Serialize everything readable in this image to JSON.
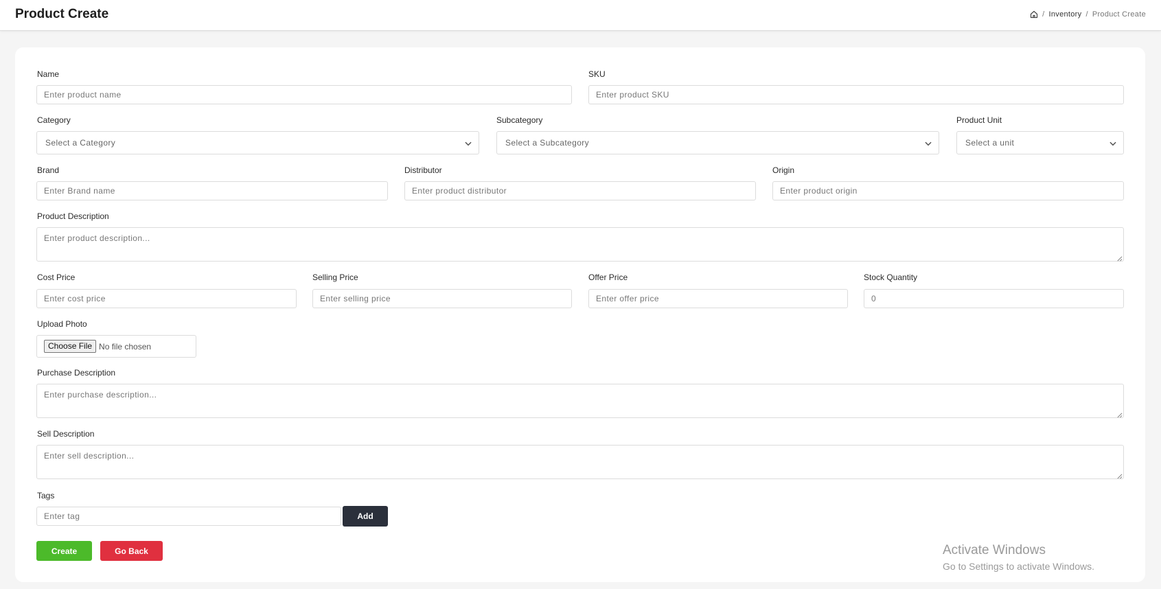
{
  "header": {
    "title": "Product Create",
    "breadcrumb": {
      "home_icon": "home-icon",
      "separator": "/",
      "items": [
        "Inventory",
        "Product Create"
      ]
    }
  },
  "form": {
    "name": {
      "label": "Name",
      "placeholder": "Enter product name"
    },
    "sku": {
      "label": "SKU",
      "placeholder": "Enter product SKU"
    },
    "category": {
      "label": "Category",
      "selected": "Select a Category"
    },
    "subcategory": {
      "label": "Subcategory",
      "selected": "Select a Subcategory"
    },
    "product_unit": {
      "label": "Product Unit",
      "selected": "Select a unit"
    },
    "brand": {
      "label": "Brand",
      "placeholder": "Enter Brand name"
    },
    "distributor": {
      "label": "Distributor",
      "placeholder": "Enter product distributor"
    },
    "origin": {
      "label": "Origin",
      "placeholder": "Enter product origin"
    },
    "product_description": {
      "label": "Product Description",
      "placeholder": "Enter product description..."
    },
    "cost_price": {
      "label": "Cost Price",
      "placeholder": "Enter cost price"
    },
    "selling_price": {
      "label": "Selling Price",
      "placeholder": "Enter selling price"
    },
    "offer_price": {
      "label": "Offer Price",
      "placeholder": "Enter offer price"
    },
    "stock_quantity": {
      "label": "Stock Quantity",
      "placeholder": "0"
    },
    "upload_photo": {
      "label": "Upload Photo",
      "button": "Choose File",
      "status": "No file chosen"
    },
    "purchase_description": {
      "label": "Purchase Description",
      "placeholder": "Enter purchase description..."
    },
    "sell_description": {
      "label": "Sell Description",
      "placeholder": "Enter sell description..."
    },
    "tags": {
      "label": "Tags",
      "placeholder": "Enter tag",
      "add_label": "Add"
    }
  },
  "actions": {
    "create_label": "Create",
    "back_label": "Go Back"
  },
  "watermark": {
    "title": "Activate Windows",
    "subtitle": "Go to Settings to activate Windows."
  },
  "colors": {
    "create": "#4cba2a",
    "go_back": "#e0303f",
    "add": "#2b303b"
  }
}
